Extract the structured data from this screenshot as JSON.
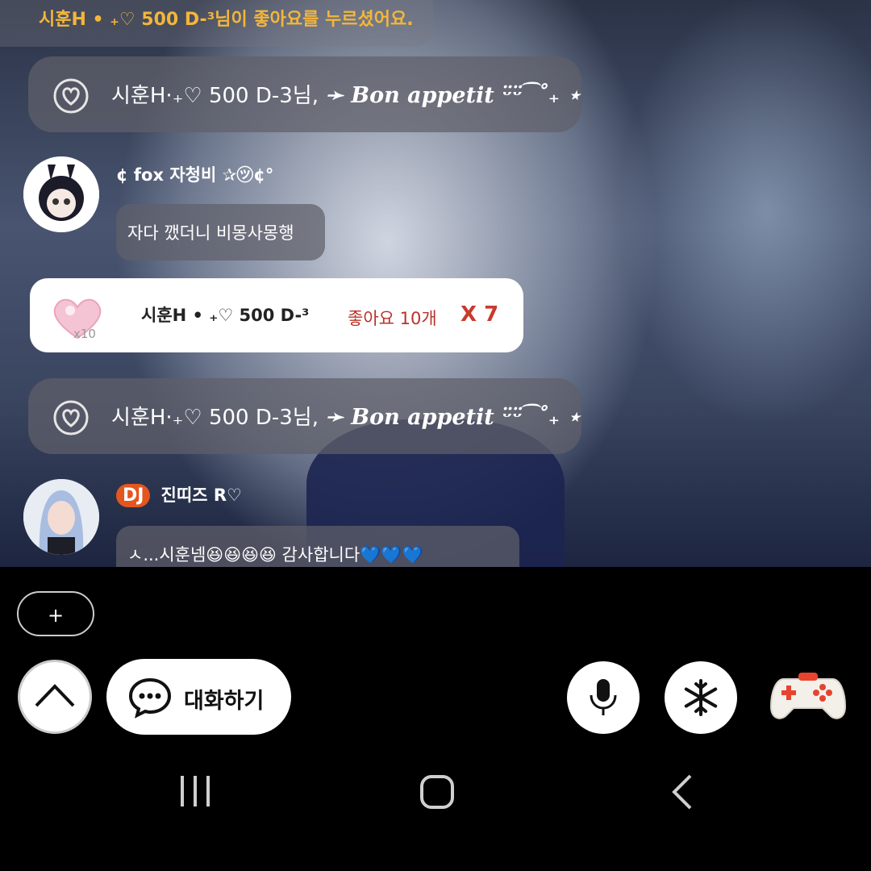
{
  "chat": {
    "top_notice": "시훈H • ₊♡ 500 D-³님이 좋아요를 누르셨어요.",
    "system_messages": [
      {
        "sender": "시훈H·₊♡ 500 D-3님,",
        "message": "➛ Bon appetit ᵕ̈ᵕ̈ ͡ ˚₊ ⋆"
      },
      {
        "sender": "시훈H·₊♡ 500 D-3님,",
        "message": "➛ Bon appetit ᵕ̈ᵕ̈ ͡ ˚₊ ⋆"
      }
    ],
    "messages": [
      {
        "nickname": "¢ fox 자청비 ✰㋡¢°",
        "text": "자다 깼더니 비몽사몽행"
      },
      {
        "badge": "DJ",
        "nickname": "진띠즈 R♡",
        "text": "ㅅ...시훈넴😆😆😆😆 감사합니다💙💙💙"
      }
    ],
    "gift": {
      "sender": "시훈H • ₊♡ 500 D-³",
      "count_text": "좋아요 10개",
      "multiplier": "X 7",
      "icon_badge": "x10"
    }
  },
  "controls": {
    "add_label": "+",
    "chat_label": "대화하기"
  },
  "icons": {
    "expand": "chevron-up-icon",
    "chat": "speech-bubble-icon",
    "mic": "microphone-icon",
    "freeze": "snowflake-icon",
    "game": "gamepad-icon",
    "nav_recent": "recent-apps-icon",
    "nav_home": "home-icon",
    "nav_back": "back-icon"
  },
  "colors": {
    "notice_text": "#f3b63a",
    "dj_badge": "#e4561f",
    "gift_count": "#b8322a"
  }
}
